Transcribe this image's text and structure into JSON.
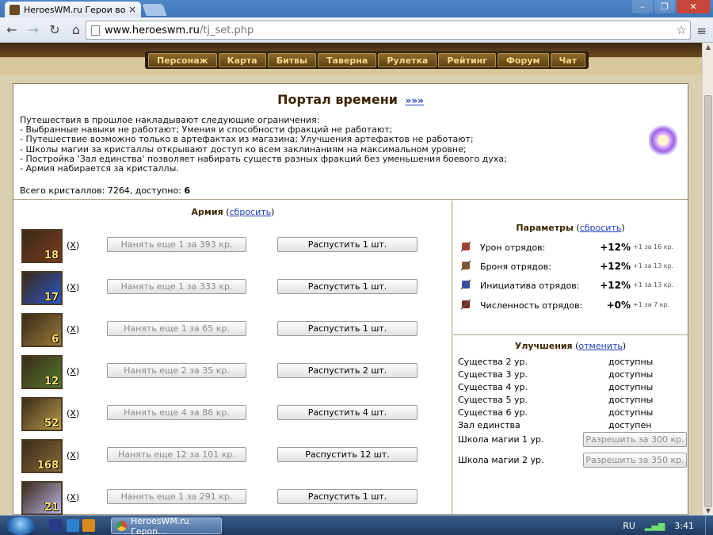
{
  "browser": {
    "tab_title": "HeroesWM.ru Герои вой",
    "tab_close": "×",
    "url_host": "www.heroeswm.ru",
    "url_path": "/tj_set.php",
    "win_min": "–",
    "win_max": "❐",
    "win_close": "✕",
    "back": "←",
    "forward": "→",
    "reload": "↻",
    "home": "⌂",
    "star": "☆",
    "menu": "≡"
  },
  "nav": [
    "Персонаж",
    "Карта",
    "Битвы",
    "Таверна",
    "Рулетка",
    "Рейтинг",
    "Форум",
    "Чат"
  ],
  "portal": {
    "title": "Портал времени",
    "more_link": "»»»",
    "restrictions": [
      "Путешествия в прошлое накладывают следующие ограничения:",
      "- Выбранные навыки не работают; Умения и способности фракций не работают;",
      "- Путешествие возможно только в артефактах из магазина; Улучшения артефактов не работают;",
      "- Школы магии за кристаллы открывают доступ ко всем заклинаниям на максимальном уровне;",
      "- Постройка 'Зал единства' позволяет набирать существ разных фракций без уменьшения боевого духа;",
      "- Армия набирается за кристаллы."
    ],
    "crystals_prefix": "Всего кристаллов: 7264, доступно: ",
    "crystals_available": "6"
  },
  "army": {
    "title": "Армия",
    "reset_open": " (",
    "reset_link": "сбросить",
    "reset_close": ")",
    "units": [
      {
        "count": "18",
        "remove": "X",
        "hire": "Нанять еще 1 за 393 кр.",
        "dismiss": "Распустить 1 шт.",
        "tint": "#7a3b1e"
      },
      {
        "count": "17",
        "remove": "X",
        "hire": "Нанять еще 1 за 333 кр.",
        "dismiss": "Распустить 1 шт.",
        "tint": "#2a55c8"
      },
      {
        "count": "6",
        "remove": "X",
        "hire": "Нанять еще 1 за 65 кр.",
        "dismiss": "Распустить 1 шт.",
        "tint": "#9a7a3a"
      },
      {
        "count": "12",
        "remove": "X",
        "hire": "Нанять еще 2 за 35 кр.",
        "dismiss": "Распустить 2 шт.",
        "tint": "#4f7a2e"
      },
      {
        "count": "52",
        "remove": "X",
        "hire": "Нанять еще 4 за 86 кр.",
        "dismiss": "Распустить 4 шт.",
        "tint": "#b89a4a"
      },
      {
        "count": "168",
        "remove": "X",
        "hire": "Нанять еще 12 за 101 кр.",
        "dismiss": "Распустить 12 шт.",
        "tint": "#8a6a3a"
      },
      {
        "count": "21",
        "remove": "X",
        "hire": "Нанять еще 1 за 291 кр.",
        "dismiss": "Распустить 1 шт.",
        "tint": "#b9b4e6"
      }
    ]
  },
  "params": {
    "title": "Параметры",
    "reset_open": " (",
    "reset_link": "сбросить",
    "reset_close": ")",
    "rows": [
      {
        "icon": "sword-icon",
        "label": "Урон отрядов:",
        "value": "+12%",
        "note": "+1 за 16 кр.",
        "color": "#b33a2a"
      },
      {
        "icon": "shield-icon",
        "label": "Броня отрядов:",
        "value": "+12%",
        "note": "+1 за 13 кр.",
        "color": "#8a5a2a"
      },
      {
        "icon": "boot-icon",
        "label": "Инициатива отрядов:",
        "value": "+12%",
        "note": "+1 за 13 кр.",
        "color": "#3a4ab3"
      },
      {
        "icon": "troops-icon",
        "label": "Численность отрядов:",
        "value": "+0%",
        "note": "+1 за 7 кр.",
        "color": "#7a2a1a"
      }
    ]
  },
  "upgrades": {
    "title": "Улучшения",
    "cancel_open": " (",
    "cancel_link": "отменить",
    "cancel_close": ")",
    "rows": [
      {
        "label": "Существа 2 ур.",
        "status": "доступны"
      },
      {
        "label": "Существа 3 ур.",
        "status": "доступны"
      },
      {
        "label": "Существа 4 ур.",
        "status": "доступны"
      },
      {
        "label": "Существа 5 ур.",
        "status": "доступны"
      },
      {
        "label": "Существа 6 ур.",
        "status": "доступны"
      },
      {
        "label": "Зал единства",
        "status": "доступен"
      }
    ],
    "magic": [
      {
        "label": "Школа магии 1 ур.",
        "button": "Разрешить за 300 кр."
      },
      {
        "label": "Школа магии 2 ур.",
        "button": "Разрешить за 350 кр."
      }
    ]
  },
  "taskbar": {
    "task_title": "HeroesWM.ru Героn...",
    "lang": "RU",
    "signal": "▂▄▆",
    "clock": "3:41"
  }
}
